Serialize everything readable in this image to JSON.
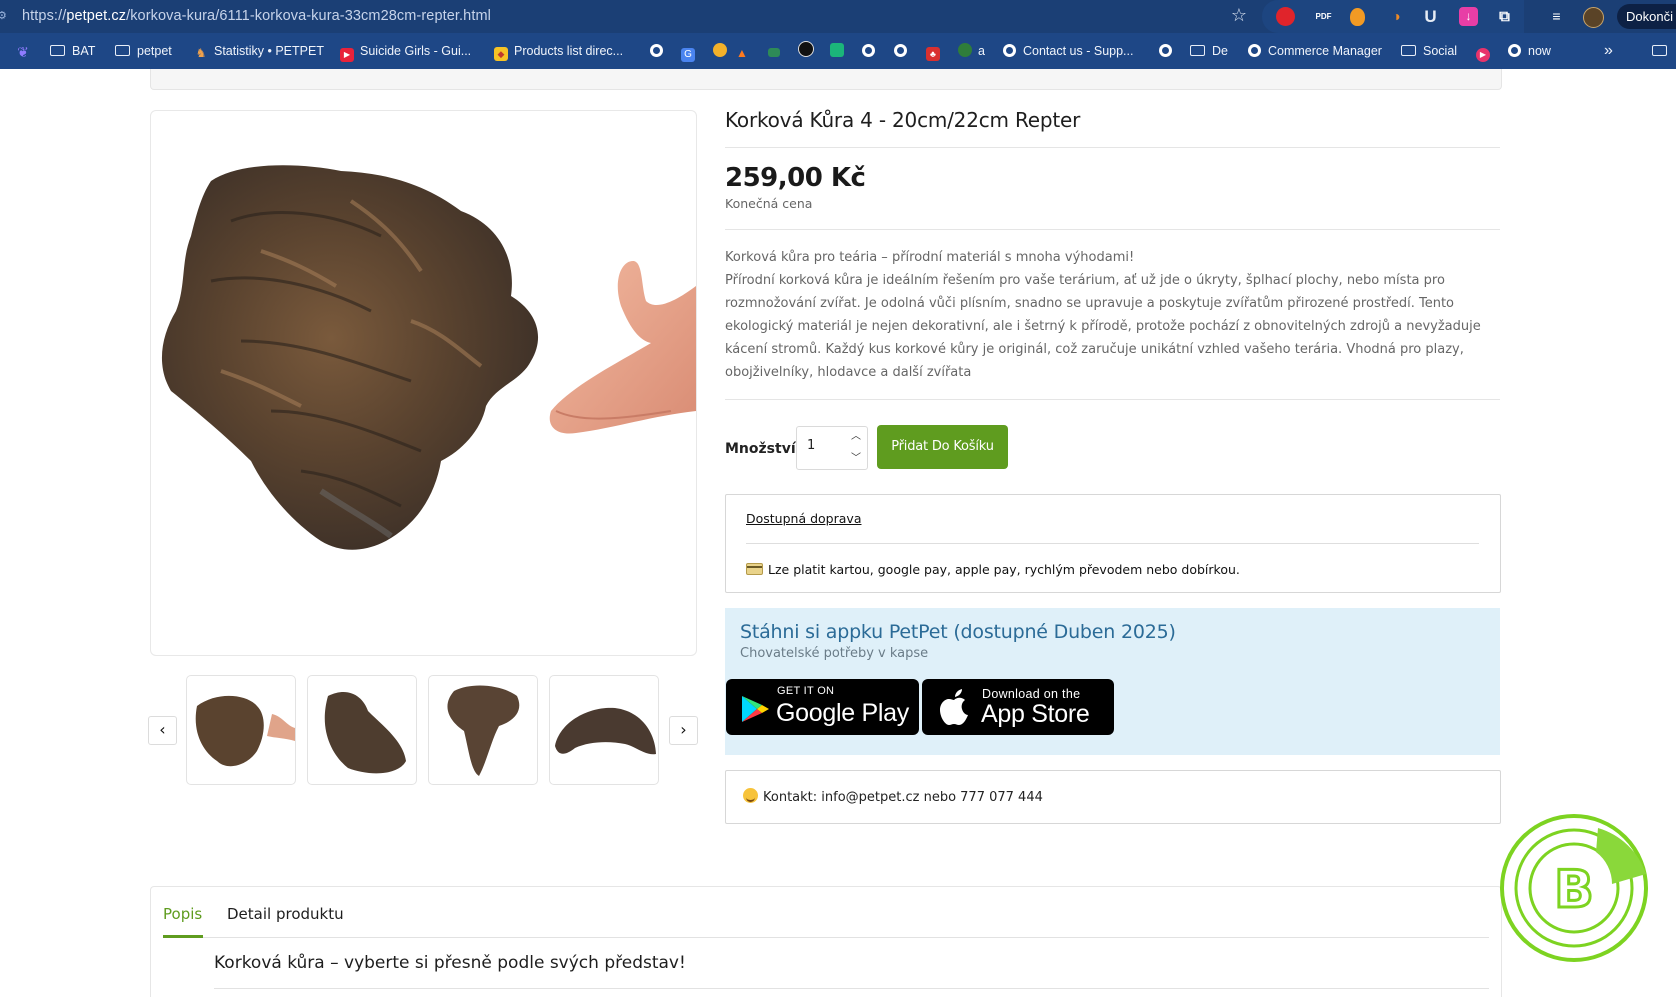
{
  "browser": {
    "url_scheme": "https://",
    "url_host": "petpet.cz",
    "url_path": "/korkova-kura/6111-korkova-kura-33cm28cm-repter.html",
    "profile_label": "Dokonči",
    "extensions": [
      "opera-icon",
      "pdf-icon",
      "egg-icon",
      "flame-icon",
      "ublock-icon",
      "download-icon",
      "puzzle-icon",
      "media-icon",
      "avatar-icon"
    ],
    "ext_pdf_label": "PDF",
    "ext_u_label": "U"
  },
  "bookmarks": [
    {
      "label": "",
      "icon": "bat-logo-icon"
    },
    {
      "label": "BAT",
      "icon": "folder-icon"
    },
    {
      "label": "petpet",
      "icon": "folder-icon"
    },
    {
      "label": "Statistiky • PETPET",
      "icon": "stats-icon"
    },
    {
      "label": "Suicide Girls - Gui...",
      "icon": "youtube-icon"
    },
    {
      "label": "Products list direc...",
      "icon": "products-icon"
    },
    {
      "label": "a",
      "icon": "a-icon"
    },
    {
      "label": "Contact us - Supp...",
      "icon": "globe-icon"
    },
    {
      "label": "De",
      "icon": "folder-icon"
    },
    {
      "label": "Commerce Manager",
      "icon": "globe-icon"
    },
    {
      "label": "Social",
      "icon": "folder-icon"
    },
    {
      "label": "now",
      "icon": "globe-icon"
    }
  ],
  "product": {
    "title": "Korková Kůra 4 - 20cm/22cm Repter",
    "price": "259,00 Kč",
    "price_note": "Konečná cena",
    "description_lead": "Korková kůra pro teária – přírodní materiál s mnoha výhodami!",
    "description_body": "Přírodní korková kůra je ideálním řešením pro vaše terárium, ať už jde o úkryty, šplhací plochy, nebo místa pro rozmnožování zvířat. Je odolná vůči plísním, snadno se upravuje a poskytuje zvířatům přirozené prostředí. Tento ekologický materiál je nejen dekorativní, ale i šetrný k přírodě, protože pochází z obnovitelných zdrojů a nevyžaduje kácení stromů. Každý kus korkové kůry je originál, což zaručuje unikátní vzhled vašeho terária. Vhodná pro plazy, obojživelníky, hlodavce a další zvířata",
    "quantity_label": "Množství",
    "quantity_value": "1",
    "add_to_cart_label": "Přidat Do Košíku"
  },
  "info": {
    "shipping_link": "Dostupná doprava",
    "payment_text": "Lze platit kartou, google pay, apple pay, rychlým převodem nebo dobírkou."
  },
  "app_promo": {
    "title": "Stáhni si appku PetPet (dostupné Duben 2025)",
    "subtitle": "Chovatelské potřeby v kapse",
    "google_small": "GET IT ON",
    "google_big": "Google Play",
    "apple_small": "Download on the",
    "apple_big": "App Store"
  },
  "contact": {
    "text": "Kontakt: info@petpet.cz nebo 777 077 444"
  },
  "tabs": {
    "items": [
      {
        "label": "Popis",
        "active": true
      },
      {
        "label": "Detail produktu",
        "active": false
      }
    ],
    "content_heading": "Korková kůra – vyberte si přesně podle svých představ!"
  },
  "colors": {
    "accent_green": "#5f9c1f",
    "app_box_bg": "#dff0f9",
    "app_title": "#2b6b97",
    "browser_bar": "#1b3f75",
    "bookmark_bar": "#1e4786",
    "badge_green": "#7dd321"
  }
}
